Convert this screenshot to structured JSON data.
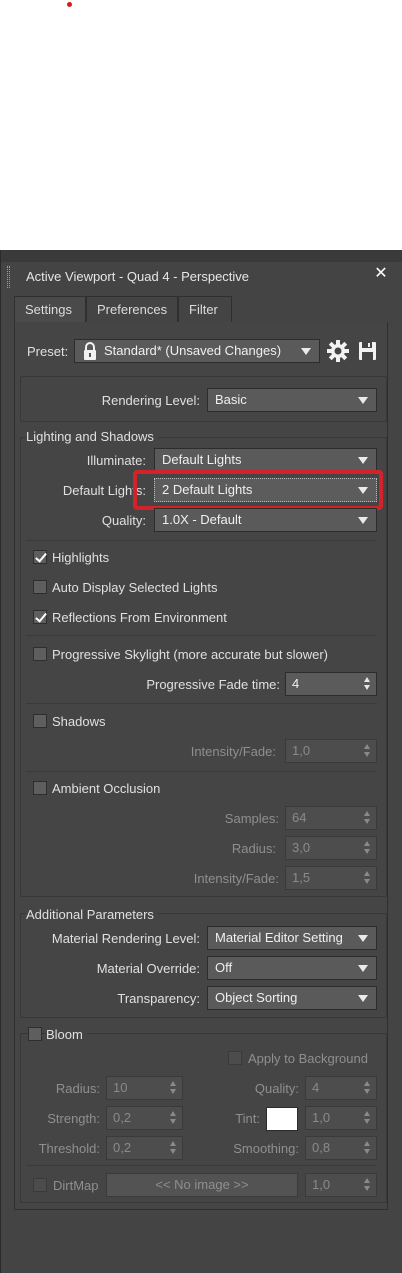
{
  "window": {
    "title": "Active Viewport - Quad 4 - Perspective",
    "close_glyph": "✕"
  },
  "tabs": [
    {
      "label": "Settings",
      "active": true
    },
    {
      "label": "Preferences",
      "active": false
    },
    {
      "label": "Filter",
      "active": false
    }
  ],
  "preset": {
    "label": "Preset:",
    "value": "Standard* (Unsaved Changes)"
  },
  "rendering_level": {
    "label": "Rendering Level:",
    "value": "Basic"
  },
  "lighting": {
    "group_title": "Lighting and Shadows",
    "illuminate_label": "Illuminate:",
    "illuminate_value": "Default Lights",
    "default_lights_label": "Default Lights:",
    "default_lights_value": "2 Default Lights",
    "quality_label": "Quality:",
    "quality_value": "1.0X - Default",
    "highlights_label": "Highlights",
    "highlights_checked": true,
    "auto_display_label": "Auto Display Selected Lights",
    "auto_display_checked": false,
    "reflections_label": "Reflections From Environment",
    "reflections_checked": true,
    "progressive_skylight_label": "Progressive Skylight (more accurate but slower)",
    "progressive_skylight_checked": false,
    "progressive_fade_label": "Progressive Fade time:",
    "progressive_fade_value": "4",
    "shadows_label": "Shadows",
    "shadows_checked": false,
    "shadows_intensity_label": "Intensity/Fade:",
    "shadows_intensity_value": "1,0",
    "ao_label": "Ambient Occlusion",
    "ao_checked": false,
    "samples_label": "Samples:",
    "samples_value": "64",
    "radius_label": "Radius:",
    "radius_value": "3,0",
    "ao_intensity_label": "Intensity/Fade:",
    "ao_intensity_value": "1,5"
  },
  "additional": {
    "group_title": "Additional Parameters",
    "material_rendering_label": "Material Rendering Level:",
    "material_rendering_value": "Material Editor Setting",
    "material_override_label": "Material Override:",
    "material_override_value": "Off",
    "transparency_label": "Transparency:",
    "transparency_value": "Object Sorting"
  },
  "bloom": {
    "label": "Bloom",
    "checked": false,
    "apply_bg_label": "Apply to Background",
    "radius_label": "Radius:",
    "radius_value": "10",
    "quality_label": "Quality:",
    "quality_value": "4",
    "strength_label": "Strength:",
    "strength_value": "0,2",
    "tint_label": "Tint:",
    "tint_value": "1,0",
    "tint_color": "#ffffff",
    "threshold_label": "Threshold:",
    "threshold_value": "0,2",
    "smoothing_label": "Smoothing:",
    "smoothing_value": "0,8",
    "dirtmap_label": "DirtMap",
    "dirtmap_button": "<< No image >>",
    "dirtmap_value": "1,0"
  },
  "colors": {
    "panel_bg": "#444444",
    "highlight_border": "#d3232a",
    "text": "#dcdcdc",
    "disabled_text": "#8f8f8f"
  }
}
